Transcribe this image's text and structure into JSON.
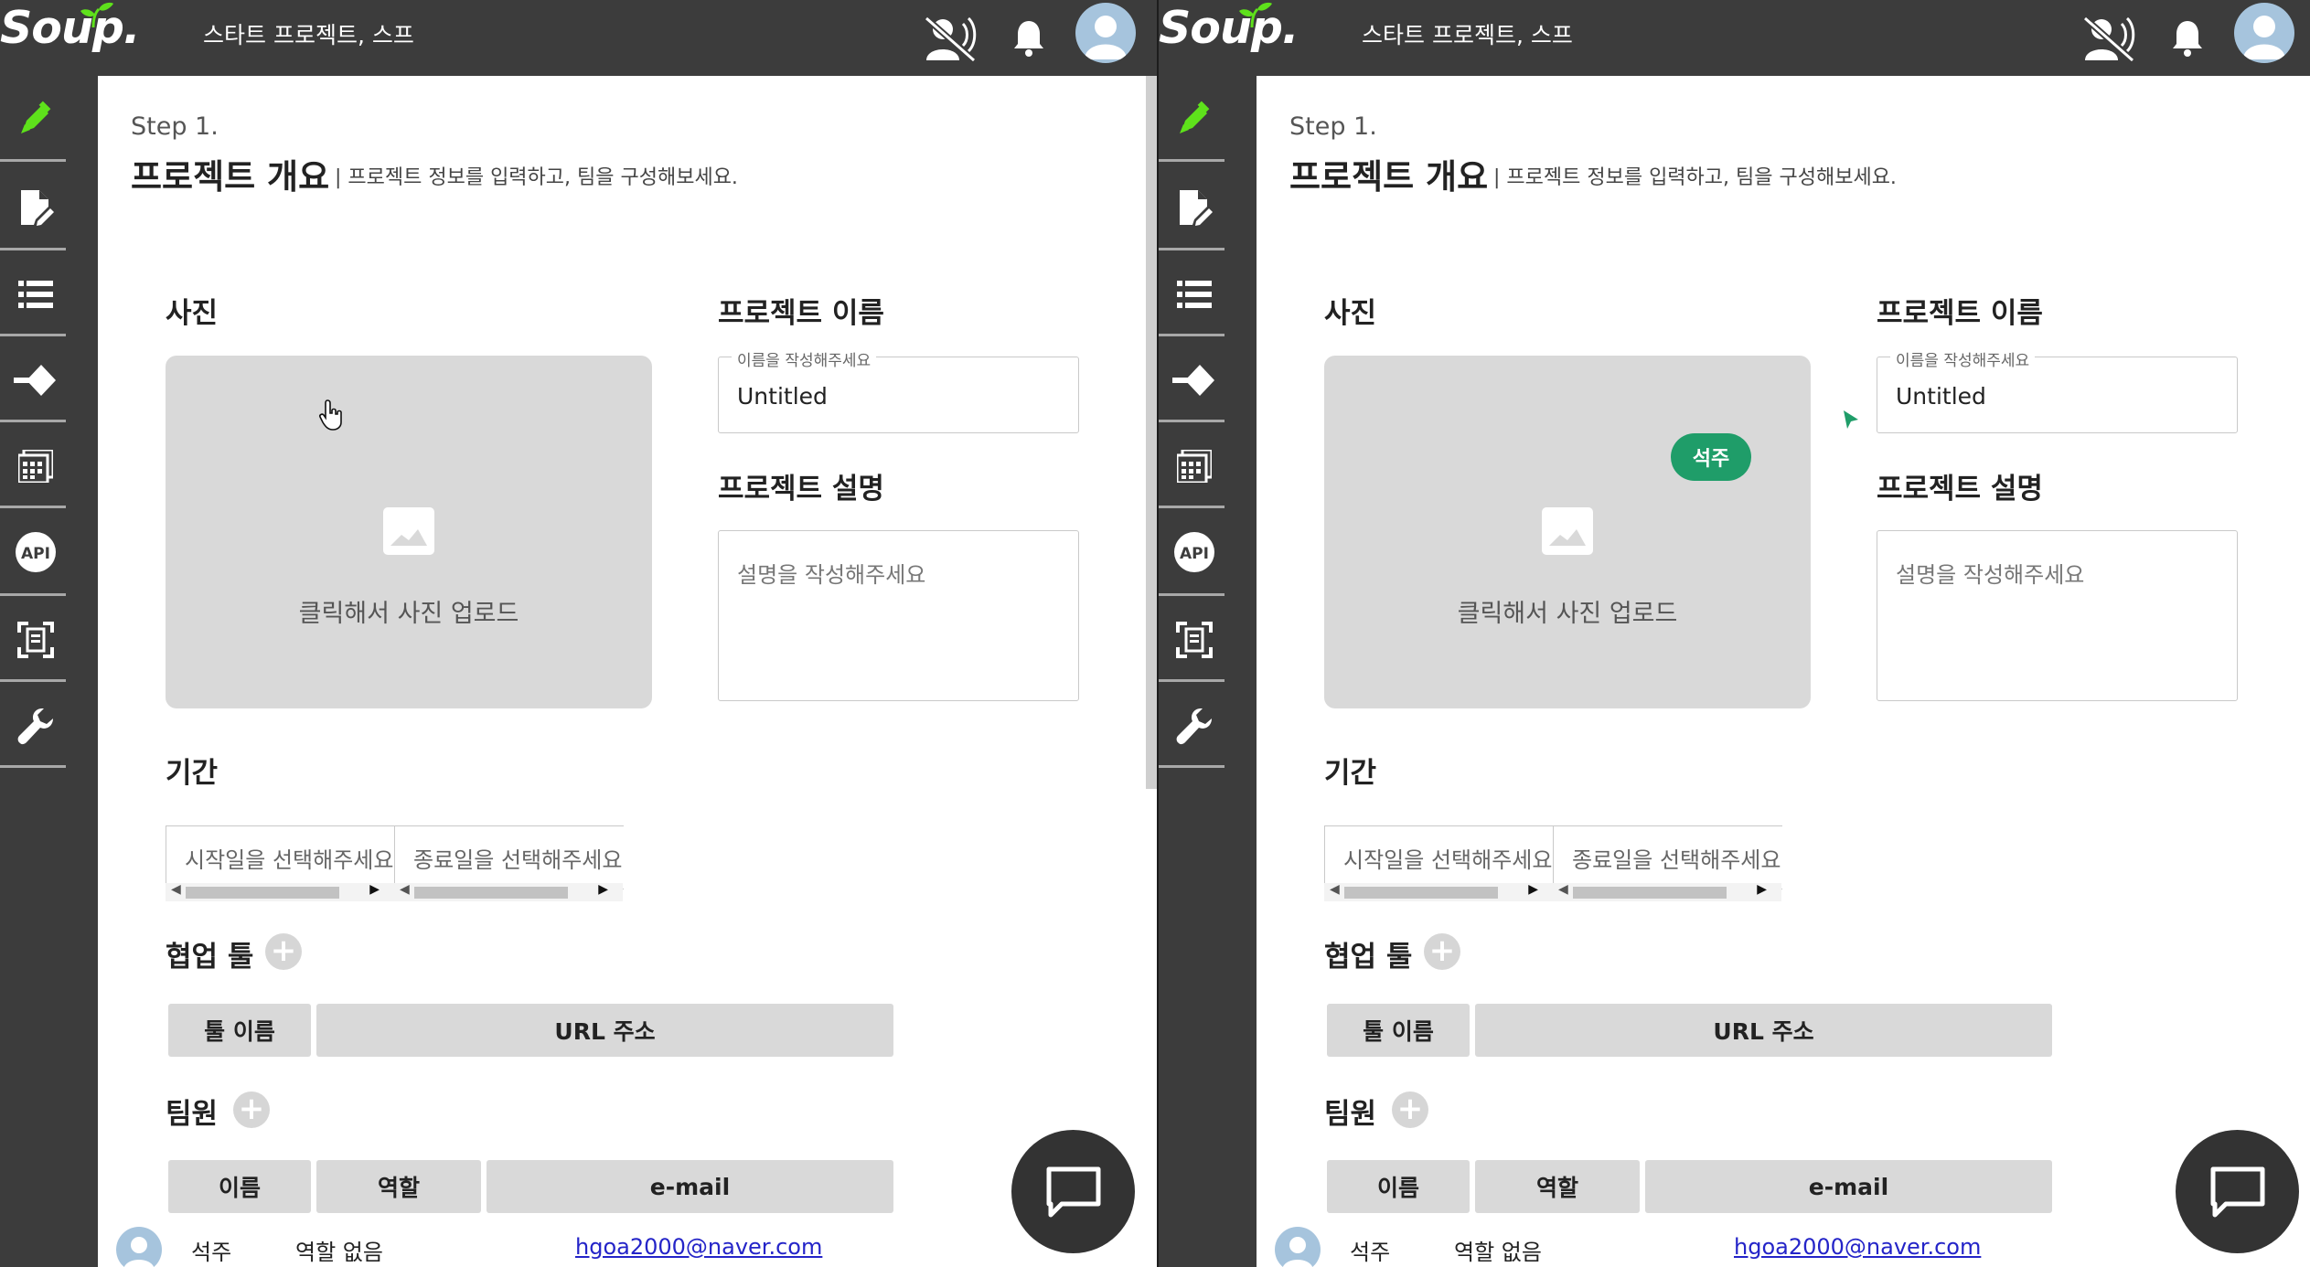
{
  "app": {
    "logo": "Soup.",
    "project_title": "스타트 프로젝트, 스프"
  },
  "sidebar": {
    "items": [
      {
        "icon": "edit-pen-icon",
        "active": true
      },
      {
        "icon": "document-edit-icon"
      },
      {
        "icon": "list-icon"
      },
      {
        "icon": "milestone-icon"
      },
      {
        "icon": "calendar-grid-icon"
      },
      {
        "icon": "api-icon",
        "label": "API"
      },
      {
        "icon": "scan-document-icon"
      },
      {
        "icon": "wrench-icon"
      }
    ]
  },
  "page": {
    "step": "Step 1.",
    "title": "프로젝트 개요",
    "subtitle": "| 프로젝트 정보를 입력하고, 팀을 구성해보세요."
  },
  "photo": {
    "heading": "사진",
    "upload_text": "클릭해서 사진 업로드"
  },
  "project_name": {
    "heading": "프로젝트 이름",
    "legend": "이름을 작성해주세요",
    "value": "Untitled"
  },
  "description": {
    "heading": "프로젝트 설명",
    "placeholder": "설명을 작성해주세요"
  },
  "period": {
    "heading": "기간",
    "start_placeholder": "시작일을 선택해주세요",
    "end_placeholder": "종료일을 선택해주세요"
  },
  "tools": {
    "heading": "협업 툴",
    "col_name": "툴 이름",
    "col_url": "URL 주소"
  },
  "team": {
    "heading": "팀원",
    "col_name": "이름",
    "col_role": "역할",
    "col_email": "e-mail",
    "members": [
      {
        "name": "석주",
        "role": "역할 없음",
        "email": "hgoa2000@naver.com"
      }
    ]
  },
  "presence_badge": "석주",
  "colors": {
    "accent_green": "#5ee11b",
    "badge_green": "#1f9d69",
    "header_bg": "#3c3c3c"
  }
}
